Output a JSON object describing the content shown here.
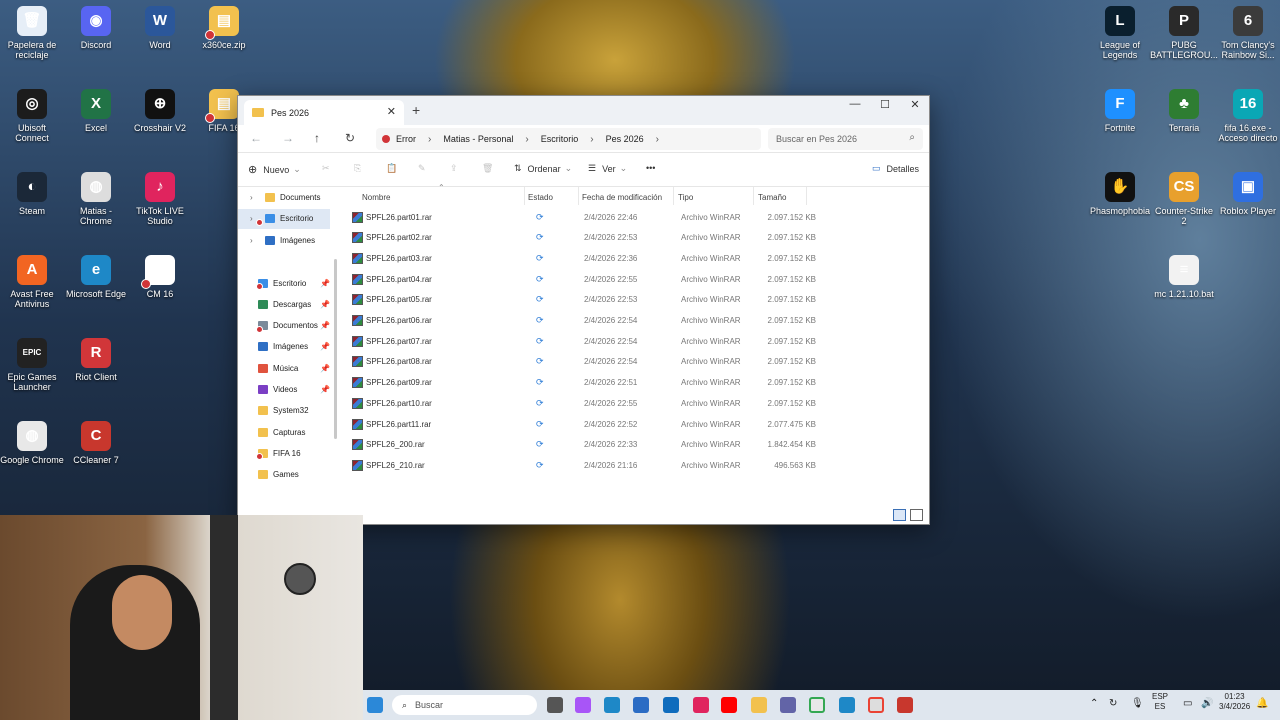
{
  "desktop": {
    "left_icons": [
      {
        "label": "Papelera de reciclaje",
        "color": "#e6eef7",
        "glyph": "🗑",
        "error": false
      },
      {
        "label": "Discord",
        "color": "#5865f2",
        "glyph": "◉",
        "error": false
      },
      {
        "label": "Word",
        "color": "#2b579a",
        "glyph": "W",
        "error": false
      },
      {
        "label": "x360ce.zip",
        "color": "#f2c14e",
        "glyph": "▤",
        "error": true
      },
      {
        "label": "Ubisoft Connect",
        "color": "#1c1c1c",
        "glyph": "◎",
        "error": false
      },
      {
        "label": "Excel",
        "color": "#217346",
        "glyph": "X",
        "error": false
      },
      {
        "label": "Crosshair V2",
        "color": "#111111",
        "glyph": "⊕",
        "error": false
      },
      {
        "label": "FIFA 16",
        "color": "#f2c14e",
        "glyph": "▤",
        "error": true
      },
      {
        "label": "Steam",
        "color": "#1b2838",
        "glyph": "◐",
        "error": false
      },
      {
        "label": "Matias - Chrome",
        "color": "#dddddd",
        "glyph": "◍",
        "error": false
      },
      {
        "label": "TikTok LIVE Studio",
        "color": "#e0245e",
        "glyph": "♪",
        "error": false
      },
      {
        "label": "Avast Free Antivirus",
        "color": "#f26522",
        "glyph": "A",
        "error": false
      },
      {
        "label": "Microsoft Edge",
        "color": "#1e88c7",
        "glyph": "e",
        "error": false
      },
      {
        "label": "CM 16",
        "color": "#ffffff",
        "glyph": "",
        "error": true
      },
      {
        "label": "Epic Games Launcher",
        "color": "#222222",
        "glyph": "EPIC",
        "error": false
      },
      {
        "label": "Riot Client",
        "color": "#d13639",
        "glyph": "R",
        "error": false
      },
      {
        "label": "Google Chrome",
        "color": "#e8e8e8",
        "glyph": "◍",
        "error": false
      },
      {
        "label": "CCleaner 7",
        "color": "#c8372d",
        "glyph": "C",
        "error": false
      }
    ],
    "right_icons": [
      {
        "label": "League of Legends",
        "color": "#0a1f2e",
        "glyph": "L"
      },
      {
        "label": "PUBG BATTLEGROU...",
        "color": "#2a2a2a",
        "glyph": "P"
      },
      {
        "label": "Tom Clancy's Rainbow Si...",
        "color": "#3b3b3b",
        "glyph": "6"
      },
      {
        "label": "Fortnite",
        "color": "#1e90ff",
        "glyph": "F"
      },
      {
        "label": "Terraria",
        "color": "#2e7d32",
        "glyph": "♣"
      },
      {
        "label": "fifa 16.exe - Acceso directo",
        "color": "#0aa7b5",
        "glyph": "16"
      },
      {
        "label": "Phasmophobia",
        "color": "#111111",
        "glyph": "✋"
      },
      {
        "label": "Counter-Strike 2",
        "color": "#e8a02d",
        "glyph": "CS"
      },
      {
        "label": "Roblox Player",
        "color": "#2f6fe0",
        "glyph": "▣"
      },
      {
        "label": "mc 1.21.10.bat",
        "color": "#f2f2f2",
        "glyph": "≡"
      }
    ]
  },
  "explorer": {
    "tab_title": "Pes 2026",
    "breadcrumb": {
      "status": "Error",
      "parts": [
        "Matias - Personal",
        "Escritorio",
        "Pes 2026"
      ]
    },
    "search_placeholder": "Buscar en Pes 2026",
    "commands": {
      "new": "Nuevo",
      "sort": "Ordenar",
      "view": "Ver",
      "more": "•••",
      "details": "Detalles"
    },
    "nav_tree": [
      {
        "label": "Documents",
        "color": "#f2c14e",
        "selected": false,
        "error": false,
        "pin": false
      },
      {
        "label": "Escritorio",
        "color": "#3a8ee6",
        "selected": true,
        "error": true,
        "pin": false
      },
      {
        "label": "Imágenes",
        "color": "#2f6fc4",
        "selected": false,
        "error": false,
        "pin": false
      }
    ],
    "nav_quick": [
      {
        "label": "Escritorio",
        "color": "#3a8ee6",
        "error": true,
        "pin": true
      },
      {
        "label": "Descargas",
        "color": "#2e8b57",
        "error": false,
        "pin": true
      },
      {
        "label": "Documentos",
        "color": "#7a8a9a",
        "error": true,
        "pin": true
      },
      {
        "label": "Imágenes",
        "color": "#2f6fc4",
        "error": false,
        "pin": true
      },
      {
        "label": "Música",
        "color": "#e0533e",
        "error": false,
        "pin": true
      },
      {
        "label": "Videos",
        "color": "#7b3fc4",
        "error": false,
        "pin": true
      },
      {
        "label": "System32",
        "color": "#f2c14e",
        "error": false,
        "pin": false
      },
      {
        "label": "Capturas",
        "color": "#f2c14e",
        "error": false,
        "pin": false
      },
      {
        "label": "FIFA 16",
        "color": "#f2c14e",
        "error": true,
        "pin": false
      },
      {
        "label": "Games",
        "color": "#f2c14e",
        "error": false,
        "pin": false
      }
    ],
    "columns": {
      "name": "Nombre",
      "state": "Estado",
      "date": "Fecha de modificación",
      "type": "Tipo",
      "size": "Tamaño"
    },
    "files": [
      {
        "name": "SPFL26.part01.rar",
        "state": "⟳",
        "date": "2/4/2026 22:46",
        "type": "Archivo WinRAR",
        "size": "2.097.152 KB"
      },
      {
        "name": "SPFL26.part02.rar",
        "state": "⟳",
        "date": "2/4/2026 22:53",
        "type": "Archivo WinRAR",
        "size": "2.097.152 KB"
      },
      {
        "name": "SPFL26.part03.rar",
        "state": "⟳",
        "date": "2/4/2026 22:36",
        "type": "Archivo WinRAR",
        "size": "2.097.152 KB"
      },
      {
        "name": "SPFL26.part04.rar",
        "state": "⟳",
        "date": "2/4/2026 22:55",
        "type": "Archivo WinRAR",
        "size": "2.097.152 KB"
      },
      {
        "name": "SPFL26.part05.rar",
        "state": "⟳",
        "date": "2/4/2026 22:53",
        "type": "Archivo WinRAR",
        "size": "2.097.152 KB"
      },
      {
        "name": "SPFL26.part06.rar",
        "state": "⟳",
        "date": "2/4/2026 22:54",
        "type": "Archivo WinRAR",
        "size": "2.097.152 KB"
      },
      {
        "name": "SPFL26.part07.rar",
        "state": "⟳",
        "date": "2/4/2026 22:54",
        "type": "Archivo WinRAR",
        "size": "2.097.152 KB"
      },
      {
        "name": "SPFL26.part08.rar",
        "state": "⟳",
        "date": "2/4/2026 22:54",
        "type": "Archivo WinRAR",
        "size": "2.097.152 KB"
      },
      {
        "name": "SPFL26.part09.rar",
        "state": "⟳",
        "date": "2/4/2026 22:51",
        "type": "Archivo WinRAR",
        "size": "2.097.152 KB"
      },
      {
        "name": "SPFL26.part10.rar",
        "state": "⟳",
        "date": "2/4/2026 22:55",
        "type": "Archivo WinRAR",
        "size": "2.097.152 KB"
      },
      {
        "name": "SPFL26.part11.rar",
        "state": "⟳",
        "date": "2/4/2026 22:52",
        "type": "Archivo WinRAR",
        "size": "2.077.475 KB"
      },
      {
        "name": "SPFL26_200.rar",
        "state": "⟳",
        "date": "2/4/2026 22:33",
        "type": "Archivo WinRAR",
        "size": "1.842.454 KB"
      },
      {
        "name": "SPFL26_210.rar",
        "state": "⟳",
        "date": "2/4/2026 21:16",
        "type": "Archivo WinRAR",
        "size": "496.563 KB"
      }
    ]
  },
  "taskbar": {
    "search_placeholder": "Buscar",
    "language_top": "ESP",
    "language_bottom": "ES",
    "time": "01:23",
    "date": "3/4/2026"
  }
}
